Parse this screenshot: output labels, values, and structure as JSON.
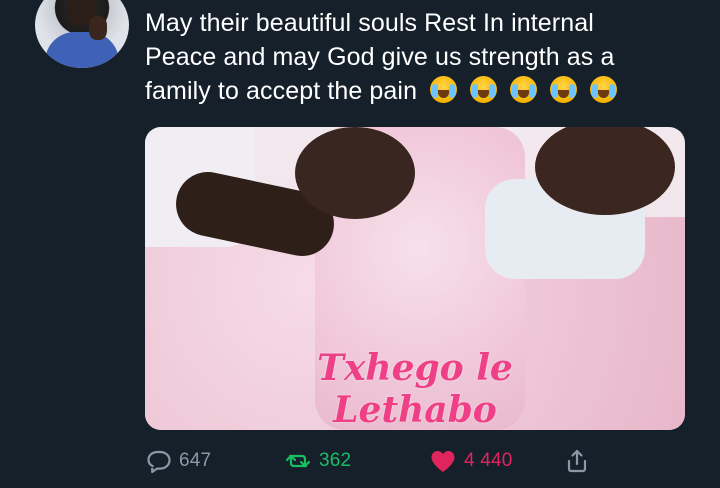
{
  "tweet": {
    "text_line1": "May their beautiful souls Rest In internal",
    "text_line2": "Peace and may God give us strength as a",
    "text_line3": "family to accept the pain",
    "emoji_count": 5
  },
  "media": {
    "caption": "Txhego le Lethabo"
  },
  "actions": {
    "reply_count": "647",
    "retweet_count": "362",
    "like_count": "4 440"
  },
  "icons": {
    "reply": "reply-icon",
    "retweet": "retweet-icon",
    "like": "heart-icon",
    "share": "share-icon"
  },
  "colors": {
    "background": "#15202b",
    "text": "#ffffff",
    "muted": "#8b98a5",
    "retweet": "#17bf63",
    "like": "#e0245e",
    "caption": "#ef3f86"
  }
}
